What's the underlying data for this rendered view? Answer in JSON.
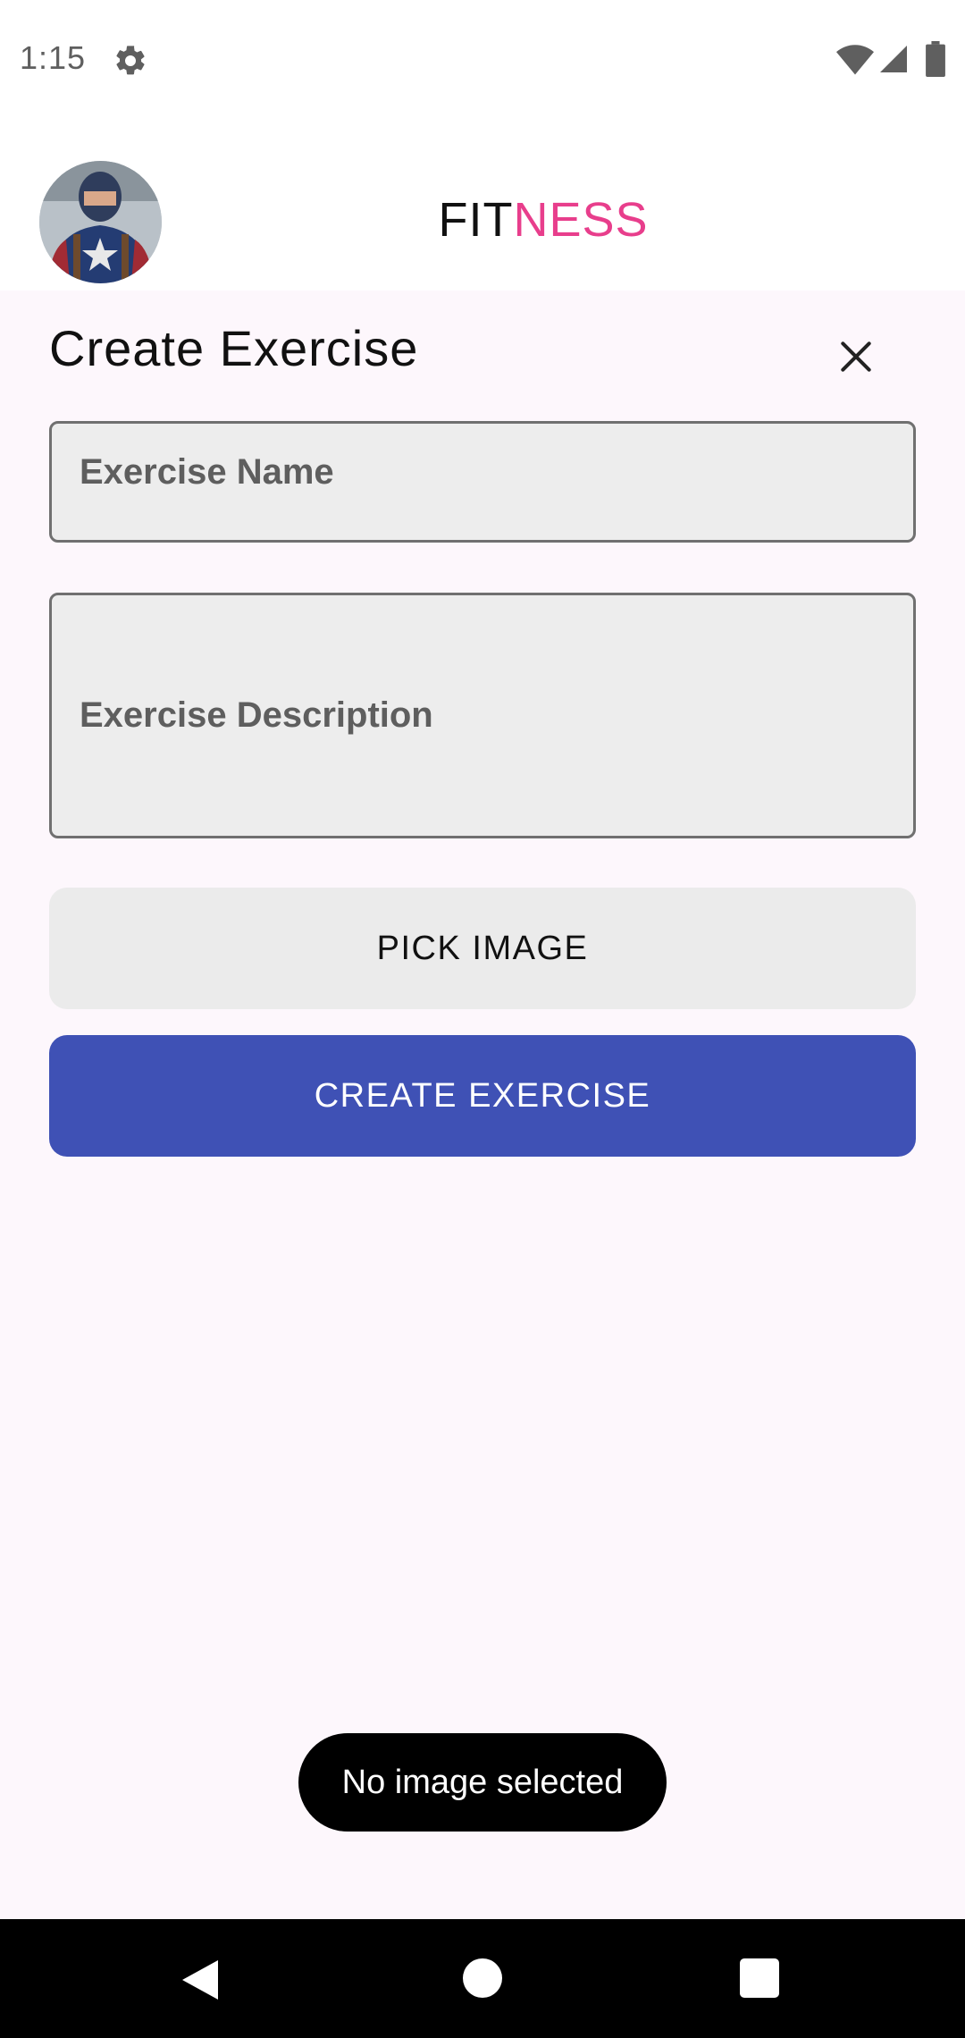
{
  "status_bar": {
    "time": "1:15",
    "icons": [
      "gear-icon",
      "wifi-icon",
      "signal-icon",
      "battery-icon"
    ]
  },
  "header": {
    "brand_part1": "FIT",
    "brand_part2": "NESS",
    "brand_accent_color": "#e83e8c",
    "avatar_icon": "user-avatar"
  },
  "form": {
    "title": "Create Exercise",
    "close_icon": "close-icon",
    "name_placeholder": "Exercise Name",
    "description_placeholder": "Exercise Description",
    "pick_image_label": "PICK IMAGE",
    "create_label": "CREATE EXERCISE",
    "create_button_color": "#3f51b5"
  },
  "toast": {
    "message": "No image selected"
  },
  "nav_bar": {
    "icons": [
      "back-icon",
      "home-icon",
      "recents-icon"
    ]
  }
}
